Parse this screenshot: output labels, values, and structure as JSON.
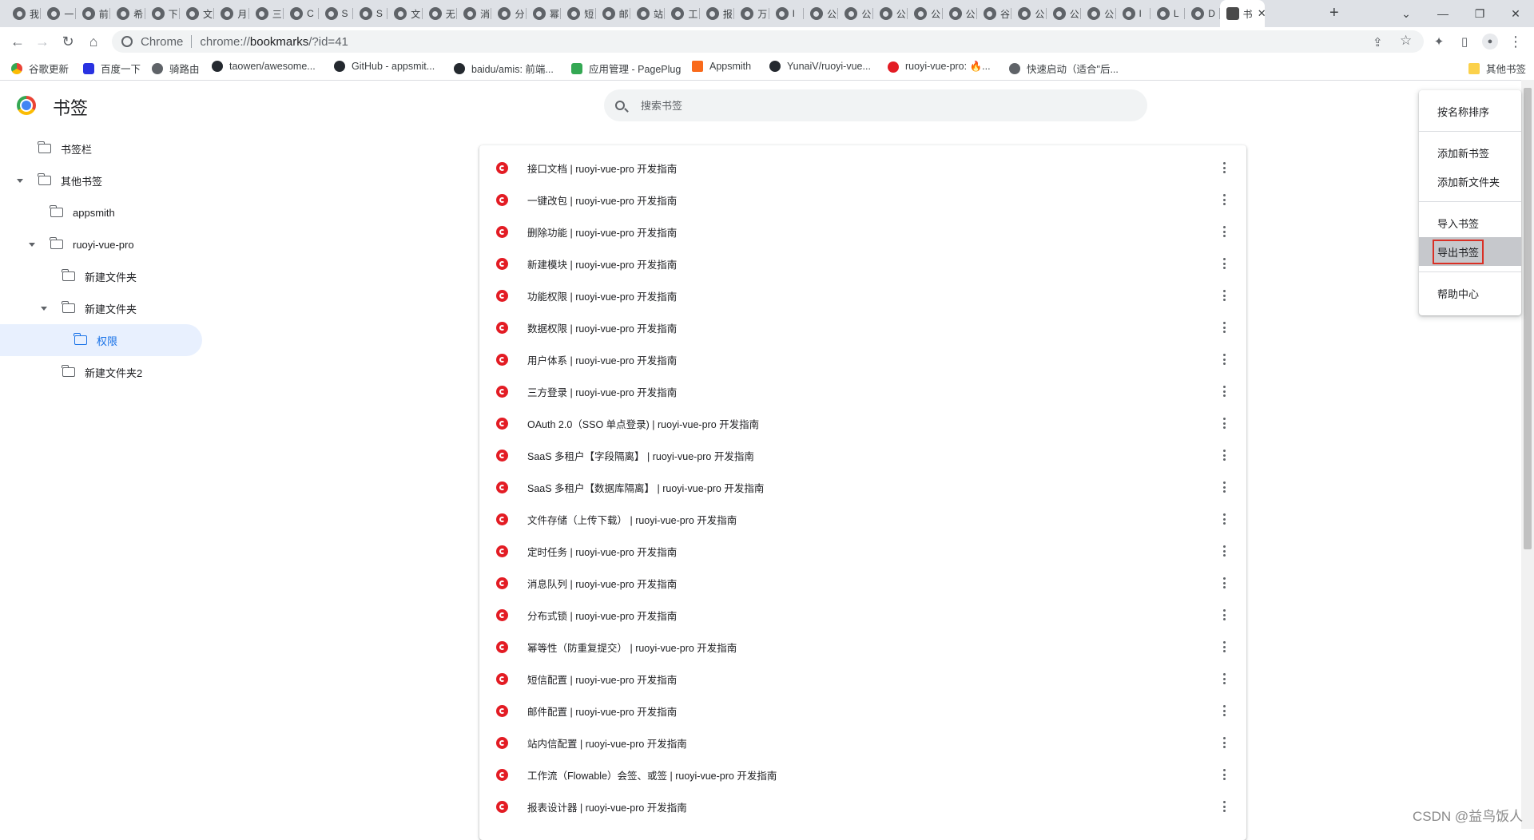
{
  "tabs": [
    {
      "label": "我"
    },
    {
      "label": "一"
    },
    {
      "label": "前"
    },
    {
      "label": "希"
    },
    {
      "label": "下"
    },
    {
      "label": "文"
    },
    {
      "label": "月"
    },
    {
      "label": "三"
    },
    {
      "label": "C"
    },
    {
      "label": "S"
    },
    {
      "label": "S"
    },
    {
      "label": "文"
    },
    {
      "label": "无"
    },
    {
      "label": "消"
    },
    {
      "label": "分"
    },
    {
      "label": "幂"
    },
    {
      "label": "短"
    },
    {
      "label": "邮"
    },
    {
      "label": "站"
    },
    {
      "label": "工"
    },
    {
      "label": "报"
    },
    {
      "label": "万"
    },
    {
      "label": "I"
    },
    {
      "label": "公"
    },
    {
      "label": "公"
    },
    {
      "label": "公"
    },
    {
      "label": "公"
    },
    {
      "label": "公"
    },
    {
      "label": "谷"
    },
    {
      "label": "公"
    },
    {
      "label": "公"
    },
    {
      "label": "公"
    },
    {
      "label": "I"
    },
    {
      "label": "L"
    },
    {
      "label": "D"
    }
  ],
  "active_tab": {
    "label": "书",
    "close": "✕"
  },
  "new_tab_label": "+",
  "window_controls": {
    "tabsearch": "⌄",
    "minimize": "—",
    "restore": "❐",
    "close": "✕"
  },
  "toolbar": {
    "back": "←",
    "forward": "→",
    "reload": "↻",
    "home": "⌂"
  },
  "omnibox": {
    "site": "Chrome",
    "url_prefix": "chrome://",
    "url_host": "bookmarks",
    "url_rest": "/?id=41"
  },
  "omnibox_actions": {
    "share": "⇪",
    "star": "☆",
    "extensions": "✦",
    "sidepanel": "▯",
    "profile": "●",
    "menu": "⋮"
  },
  "bookmarks_bar": [
    {
      "label": "谷歌更新",
      "icon": "chrome"
    },
    {
      "label": "百度一下",
      "icon": "paw"
    },
    {
      "label": "骑路由",
      "icon": "gear"
    },
    {
      "label": "taowen/awesome...",
      "icon": "github"
    },
    {
      "label": "GitHub - appsmit...",
      "icon": "github"
    },
    {
      "label": "baidu/amis: 前端...",
      "icon": "github"
    },
    {
      "label": "应用管理 - PagePlug",
      "icon": "pageplug"
    },
    {
      "label": "Appsmith",
      "icon": "appsmith"
    },
    {
      "label": "YunaiV/ruoyi-vue...",
      "icon": "github"
    },
    {
      "label": "ruoyi-vue-pro: 🔥...",
      "icon": "ruoyi"
    },
    {
      "label": "快速启动（适合\"后...",
      "icon": "gear"
    }
  ],
  "other_bookmarks": {
    "label": "其他书签",
    "icon": "folder"
  },
  "page": {
    "title": "书签",
    "search_placeholder": "搜索书签"
  },
  "tree": [
    {
      "label": "书签栏",
      "level": 0,
      "expanded": null,
      "selected": false
    },
    {
      "label": "其他书签",
      "level": 0,
      "expanded": true,
      "selected": false
    },
    {
      "label": "appsmith",
      "level": 1,
      "expanded": null,
      "selected": false
    },
    {
      "label": "ruoyi-vue-pro",
      "level": 1,
      "expanded": true,
      "selected": false
    },
    {
      "label": "新建文件夹",
      "level": 2,
      "expanded": null,
      "selected": false
    },
    {
      "label": "新建文件夹",
      "level": 2,
      "expanded": true,
      "selected": false
    },
    {
      "label": "权限",
      "level": 3,
      "expanded": null,
      "selected": true
    },
    {
      "label": "新建文件夹2",
      "level": 2,
      "expanded": null,
      "selected": false
    }
  ],
  "bookmarks": [
    {
      "title": "接口文档 | ruoyi-vue-pro 开发指南"
    },
    {
      "title": "一键改包 | ruoyi-vue-pro 开发指南"
    },
    {
      "title": "删除功能 | ruoyi-vue-pro 开发指南"
    },
    {
      "title": "新建模块 | ruoyi-vue-pro 开发指南"
    },
    {
      "title": "功能权限 | ruoyi-vue-pro 开发指南"
    },
    {
      "title": "数据权限 | ruoyi-vue-pro 开发指南"
    },
    {
      "title": "用户体系 | ruoyi-vue-pro 开发指南"
    },
    {
      "title": "三方登录 | ruoyi-vue-pro 开发指南"
    },
    {
      "title": "OAuth 2.0（SSO 单点登录) | ruoyi-vue-pro 开发指南"
    },
    {
      "title": "SaaS 多租户【字段隔离】 | ruoyi-vue-pro 开发指南"
    },
    {
      "title": "SaaS 多租户【数据库隔离】 | ruoyi-vue-pro 开发指南"
    },
    {
      "title": "文件存储（上传下载） | ruoyi-vue-pro 开发指南"
    },
    {
      "title": "定时任务 | ruoyi-vue-pro 开发指南"
    },
    {
      "title": "消息队列 | ruoyi-vue-pro 开发指南"
    },
    {
      "title": "分布式锁 | ruoyi-vue-pro 开发指南"
    },
    {
      "title": "幂等性（防重复提交） | ruoyi-vue-pro 开发指南"
    },
    {
      "title": "短信配置 | ruoyi-vue-pro 开发指南"
    },
    {
      "title": "邮件配置 | ruoyi-vue-pro 开发指南"
    },
    {
      "title": "站内信配置 | ruoyi-vue-pro 开发指南"
    },
    {
      "title": "工作流（Flowable）会签、或签 | ruoyi-vue-pro 开发指南"
    },
    {
      "title": "报表设计器 | ruoyi-vue-pro 开发指南"
    }
  ],
  "menu": {
    "sort": "按名称排序",
    "add_bookmark": "添加新书签",
    "add_folder": "添加新文件夹",
    "import": "导入书签",
    "export": "导出书签",
    "help": "帮助中心"
  },
  "highlight_color": "#d93025",
  "accent_color": "#1a73e8",
  "watermark": "CSDN @益鸟饭人"
}
